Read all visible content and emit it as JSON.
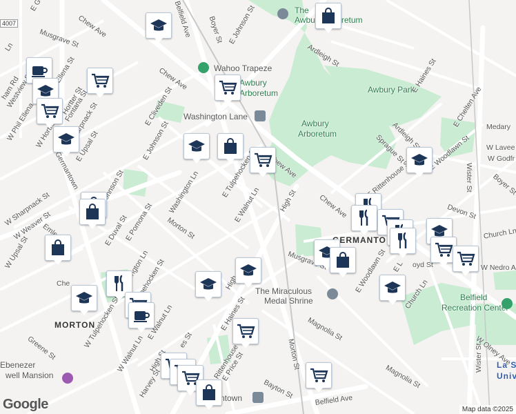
{
  "attribution": "Map data ©2025",
  "logo": "Google",
  "route_shield": "4007",
  "colors": {
    "park": "#c9ecd3",
    "road": "#ffffff",
    "marker_icon": "#1d3557",
    "marker_border": "#b9c6d6",
    "poi_green": "#34a06a",
    "poi_purple": "#9c5bb0",
    "poi_gray": "#7a8a99"
  },
  "parks": [
    {
      "name": "The Great Awbury Arboretum",
      "label": "The\nAwbury Arboretum"
    },
    {
      "name": "Awbury Arboretum",
      "label": "Awbury\nArboretum"
    },
    {
      "name": "Awbury Park",
      "label": "Awbury Park"
    },
    {
      "name": "Belfield Recreation Center",
      "label": "Belfield\nRecreation Center"
    }
  ],
  "places": {
    "wahoo": "Wahoo Trapeze",
    "washington_lane": "Washington Lane",
    "arboretum1": "Awbury",
    "arboretum1b": "Arboretum",
    "arboretum2": "Awbury",
    "arboretum2b": "Arboretum",
    "awbury_park": "Awbury Park",
    "the_great": "The",
    "the_great2": "Awbury Arboretum",
    "medal": "The Miraculous",
    "medal2": "Medal Shrine",
    "belfield": "Belfield",
    "belfield2": "Recreation Center",
    "ebenezer": "Ebenezer",
    "ebenezer2": "well Mansion",
    "morton": "MORTON",
    "germantown": "GERMANTO",
    "lasalle": "La S",
    "lasalle2": "Univ",
    "town": "ntown"
  },
  "streets": {
    "chew_ave_1": "Chew Ave",
    "chew_ave_2": "Chew Ave",
    "chew_ave_3": "Chew Ave",
    "chew_ave_4": "Chew Ave",
    "belfield_ave_1": "Belfield Ave",
    "belfield_ave_2": "Belfield Ave",
    "boyer_st_1": "Boyer St",
    "boyer_st_2": "Boyer St",
    "e_johnson_st_1": "E Johnson St",
    "e_johnson_st_2": "E Johnson St",
    "johnson_st": "Johnson St",
    "ardleigh_st_1": "Ardleigh St",
    "ardleigh_st_2": "Ardleigh St",
    "e_haines_st_1": "E Haines St",
    "e_haines_st_2": "E Haines St",
    "e_chelten_ave": "E Chelten Ave",
    "medary": "Medary",
    "w_lavee": "W Lavee",
    "w_godfr": "W Godfr",
    "wister_st_1": "Wister St",
    "wister_st_2": "Wister St",
    "sprague_st": "Sprague St",
    "e_woodlawn_st_1": "E Woodlawn St",
    "e_woodlawn_st_2": "E Woodlawn St",
    "e_rittenhouse_st_1": "E Rittenhouse St",
    "e_rittenhouse_st_2": "Rittenhouse St",
    "devon_st": "Devon St",
    "church_ln_1": "Church Ln",
    "church_ln_2": "Church Ln",
    "w_nedro": "W Nedro A",
    "w_olney": "W Olney Ave",
    "high_st_1": "High St",
    "high_st_2": "High St",
    "high_st_3": "High",
    "musgrave_st_1": "Musgrave St",
    "musgrave_st_2": "Musgrave St",
    "magnolia_st_1": "Magnolia St",
    "magnolia_st_2": "Magnolia St",
    "morton_st_1": "Morton St",
    "morton_st_2": "Morton St",
    "bayton_st": "Bayton St",
    "e_price_st": "E Price St",
    "e_walnut_ln_1": "E Walnut Ln",
    "e_walnut_ln_2": "E Walnut Ln",
    "e_tulpehocken_st": "E Tulpehocken St",
    "washington_ln_1": "Washington Ln",
    "washington_ln_2": "Washington Ln",
    "e_cliveden_st": "E Cliveden St",
    "e_upsal_st": "E Upsal St",
    "e_pomona_st": "E Pomona St",
    "e_duval_st": "E Duval St",
    "germantown_ave": "Germantown",
    "emlen_st": "Emlen St",
    "w_sharpnack_st": "W Sharpnack St",
    "w_weaver_st": "W Weaver St",
    "w_upsal_st": "W Upsal St",
    "w_tulpehocken_st": "W Tulpehocken St",
    "w_walnut_ln": "W Walnut Ln",
    "tulpehocken_st": "Tulpehocken St",
    "greene_st": "Greene St",
    "harvey_st": "Harvey St",
    "w_phil_ellena": "W Phil Ellena",
    "w_hortter_st": "W Hortter St",
    "hortter_st": "Hortter St",
    "westview_st": "Westview St",
    "ellena_st": "Ellena St",
    "fontana_st": "Fontana St",
    "sharpnack_st": "Sharpnack St",
    "musgrave_nw": "Musgrave St",
    "w_gorg": "E Gorg",
    "herham_rd": "ham Rd",
    "w_ln": "Ln",
    "w_sharp2": "W Sharpnack St",
    "w_j": "W J",
    "e_lane": "E L",
    "boyd_st": "oyd St",
    "ches": "Che",
    "ks_st": "es St"
  },
  "markers": [
    {
      "type": "school",
      "name": "school-marker"
    },
    {
      "type": "shopping",
      "name": "shopping-marker"
    },
    {
      "type": "cafe",
      "name": "cafe-marker"
    },
    {
      "type": "grocery",
      "name": "grocery-marker"
    },
    {
      "type": "restaurant",
      "name": "restaurant-marker"
    }
  ]
}
